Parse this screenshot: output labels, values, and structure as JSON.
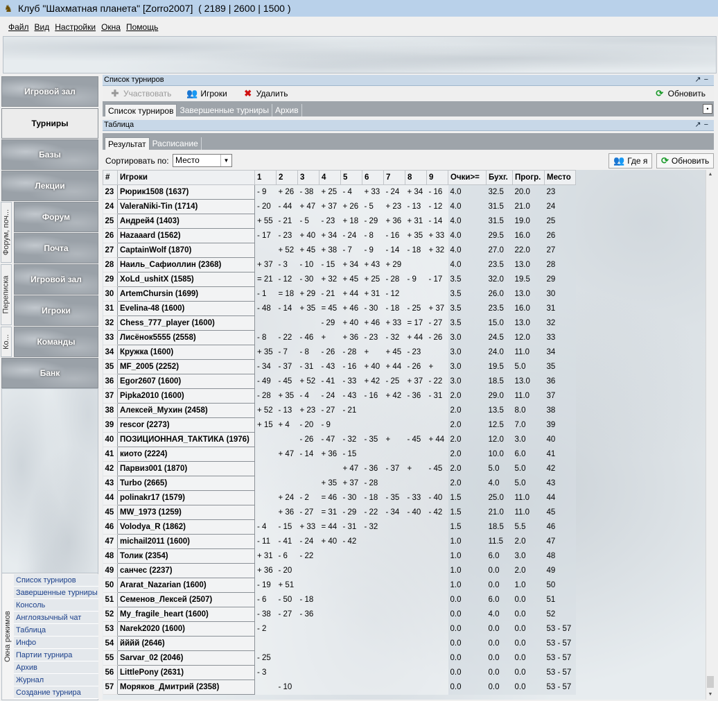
{
  "window": {
    "title": "Клуб \"Шахматная планета\" [Zorro2007]  ( 2189 | 2600 | 1500 )"
  },
  "menu": [
    "Файл",
    "Вид",
    "Настройки",
    "Окна",
    "Помощь"
  ],
  "sidebar": {
    "buttons": [
      "Игровой зал",
      "Турниры",
      "Базы",
      "Лекции",
      "Форум",
      "Почта",
      "Игровой зал",
      "Игроки",
      "Команды",
      "Банк"
    ],
    "groups": [
      "Форум, поч...",
      "Переписка",
      "Ко..."
    ],
    "modes_label": "Окна режимов",
    "modes": [
      "Список турниров",
      "Завершенные турниры",
      "Консоль",
      "Англоязычный чат",
      "Таблица",
      "Инфо",
      "Партии турнира",
      "Архив",
      "Журнал",
      "Создание турнира"
    ]
  },
  "tournament_list": {
    "header": "Список турниров",
    "toolbar": {
      "participate": "Участвовать",
      "players": "Игроки",
      "delete": "Удалить",
      "refresh": "Обновить"
    },
    "tabs": [
      "Список турниров",
      "Завершенные турниры",
      "Архив"
    ]
  },
  "table_panel": {
    "header": "Таблица",
    "tabs": [
      "Результат",
      "Расписание"
    ],
    "sort_label": "Сортировать по:",
    "sort_value": "Место",
    "where_button": "Где я",
    "refresh_button": "Обновить"
  },
  "grid": {
    "columns": [
      "#",
      "Игроки",
      "1",
      "2",
      "3",
      "4",
      "5",
      "6",
      "7",
      "8",
      "9",
      "Очки>=",
      "Бухг.",
      "Прогр.",
      "Место"
    ],
    "rows": [
      [
        "23",
        "Рюрик1508 (1637)",
        "- 9",
        "+ 26",
        "- 38",
        "+ 25",
        "- 4",
        "+ 33",
        "- 24",
        "+ 34",
        "- 16",
        "4.0",
        "32.5",
        "20.0",
        "23"
      ],
      [
        "24",
        "ValeraNiki-Tin (1714)",
        "- 20",
        "- 44",
        "+ 47",
        "+ 37",
        "+ 26",
        "- 5",
        "+ 23",
        "- 13",
        "- 12",
        "4.0",
        "31.5",
        "21.0",
        "24"
      ],
      [
        "25",
        "Андрей4 (1403)",
        "+ 55",
        "- 21",
        "- 5",
        "- 23",
        "+ 18",
        "- 29",
        "+ 36",
        "+ 31",
        "- 14",
        "4.0",
        "31.5",
        "19.0",
        "25"
      ],
      [
        "26",
        "Hazaaard (1562)",
        "- 17",
        "- 23",
        "+ 40",
        "+ 34",
        "- 24",
        "- 8",
        "- 16",
        "+ 35",
        "+ 33",
        "4.0",
        "29.5",
        "16.0",
        "26"
      ],
      [
        "27",
        "CaptainWolf (1870)",
        "",
        "+ 52",
        "+ 45",
        "+ 38",
        "- 7",
        "- 9",
        "- 14",
        "- 18",
        "+ 32",
        "4.0",
        "27.0",
        "22.0",
        "27"
      ],
      [
        "28",
        "Наиль_Сафиоллин (2368)",
        "+ 37",
        "- 3",
        "- 10",
        "- 15",
        "+ 34",
        "+ 43",
        "+ 29",
        "",
        "",
        "4.0",
        "23.5",
        "13.0",
        "28"
      ],
      [
        "29",
        "XoLd_ushitX (1585)",
        "= 21",
        "- 12",
        "- 30",
        "+ 32",
        "+ 45",
        "+ 25",
        "- 28",
        "- 9",
        "- 17",
        "3.5",
        "32.0",
        "19.5",
        "29"
      ],
      [
        "30",
        "ArtemChursin (1699)",
        "- 1",
        "= 18",
        "+ 29",
        "- 21",
        "+ 44",
        "+ 31",
        "- 12",
        "",
        "",
        "3.5",
        "26.0",
        "13.0",
        "30"
      ],
      [
        "31",
        "Evelina-48 (1600)",
        "- 48",
        "- 14",
        "+ 35",
        "= 45",
        "+ 46",
        "- 30",
        "- 18",
        "- 25",
        "+ 37",
        "3.5",
        "23.5",
        "16.0",
        "31"
      ],
      [
        "32",
        "Chess_777_player (1600)",
        "",
        "",
        "",
        "- 29",
        "+ 40",
        "+ 46",
        "+ 33",
        "= 17",
        "- 27",
        "3.5",
        "15.0",
        "13.0",
        "32"
      ],
      [
        "33",
        "Лисёнок5555 (2558)",
        "- 8",
        "- 22",
        "- 46",
        "+",
        "+ 36",
        "- 23",
        "- 32",
        "+ 44",
        "- 26",
        "3.0",
        "24.5",
        "12.0",
        "33"
      ],
      [
        "34",
        "Кружка (1600)",
        "+ 35",
        "- 7",
        "- 8",
        "- 26",
        "- 28",
        "+",
        "+ 45",
        "- 23",
        "",
        "3.0",
        "24.0",
        "11.0",
        "34"
      ],
      [
        "35",
        "MF_2005 (2252)",
        "- 34",
        "- 37",
        "- 31",
        "- 43",
        "- 16",
        "+ 40",
        "+ 44",
        "- 26",
        "+",
        "3.0",
        "19.5",
        "5.0",
        "35"
      ],
      [
        "36",
        "Egor2607 (1600)",
        "- 49",
        "- 45",
        "+ 52",
        "- 41",
        "- 33",
        "+ 42",
        "- 25",
        "+ 37",
        "- 22",
        "3.0",
        "18.5",
        "13.0",
        "36"
      ],
      [
        "37",
        "Pipka2010 (1600)",
        "- 28",
        "+ 35",
        "- 4",
        "- 24",
        "- 43",
        "- 16",
        "+ 42",
        "- 36",
        "- 31",
        "2.0",
        "29.0",
        "11.0",
        "37"
      ],
      [
        "38",
        "Алексей_Мухин (2458)",
        "+ 52",
        "- 13",
        "+ 23",
        "- 27",
        "- 21",
        "",
        "",
        "",
        "",
        "2.0",
        "13.5",
        "8.0",
        "38"
      ],
      [
        "39",
        "rescor (2273)",
        "+ 15",
        "+ 4",
        "- 20",
        "- 9",
        "",
        "",
        "",
        "",
        "",
        "2.0",
        "12.5",
        "7.0",
        "39"
      ],
      [
        "40",
        "ПОЗИЦИОННАЯ_ТАКТИКА (1976)",
        "",
        "",
        "- 26",
        "- 47",
        "- 32",
        "- 35",
        "+",
        "- 45",
        "+ 44",
        "2.0",
        "12.0",
        "3.0",
        "40"
      ],
      [
        "41",
        "киото (2224)",
        "",
        "+ 47",
        "- 14",
        "+ 36",
        "- 15",
        "",
        "",
        "",
        "",
        "2.0",
        "10.0",
        "6.0",
        "41"
      ],
      [
        "42",
        "Парвиз001 (1870)",
        "",
        "",
        "",
        "",
        "+ 47",
        "- 36",
        "- 37",
        "+",
        "- 45",
        "2.0",
        "5.0",
        "5.0",
        "42"
      ],
      [
        "43",
        "Turbo (2665)",
        "",
        "",
        "",
        "+ 35",
        "+ 37",
        "- 28",
        "",
        "",
        "",
        "2.0",
        "4.0",
        "5.0",
        "43"
      ],
      [
        "44",
        "polinakr17 (1579)",
        "",
        "+ 24",
        "- 2",
        "= 46",
        "- 30",
        "- 18",
        "- 35",
        "- 33",
        "- 40",
        "1.5",
        "25.0",
        "11.0",
        "44"
      ],
      [
        "45",
        "MW_1973 (1259)",
        "",
        "+ 36",
        "- 27",
        "= 31",
        "- 29",
        "- 22",
        "- 34",
        "- 40",
        "- 42",
        "1.5",
        "21.0",
        "11.0",
        "45"
      ],
      [
        "46",
        "Volodya_R (1862)",
        "- 4",
        "- 15",
        "+ 33",
        "= 44",
        "- 31",
        "- 32",
        "",
        "",
        "",
        "1.5",
        "18.5",
        "5.5",
        "46"
      ],
      [
        "47",
        "michail2011 (1600)",
        "- 11",
        "- 41",
        "- 24",
        "+ 40",
        "- 42",
        "",
        "",
        "",
        "",
        "1.0",
        "11.5",
        "2.0",
        "47"
      ],
      [
        "48",
        "Толик (2354)",
        "+ 31",
        "- 6",
        "- 22",
        "",
        "",
        "",
        "",
        "",
        "",
        "1.0",
        "6.0",
        "3.0",
        "48"
      ],
      [
        "49",
        "санчес (2237)",
        "+ 36",
        "- 20",
        "",
        "",
        "",
        "",
        "",
        "",
        "",
        "1.0",
        "0.0",
        "2.0",
        "49"
      ],
      [
        "50",
        "Ararat_Nazarian (1600)",
        "- 19",
        "+ 51",
        "",
        "",
        "",
        "",
        "",
        "",
        "",
        "1.0",
        "0.0",
        "1.0",
        "50"
      ],
      [
        "51",
        "Семенов_Лексей (2507)",
        "- 6",
        "- 50",
        "- 18",
        "",
        "",
        "",
        "",
        "",
        "",
        "0.0",
        "6.0",
        "0.0",
        "51"
      ],
      [
        "52",
        "My_fragile_heart (1600)",
        "- 38",
        "- 27",
        "- 36",
        "",
        "",
        "",
        "",
        "",
        "",
        "0.0",
        "4.0",
        "0.0",
        "52"
      ],
      [
        "53",
        "Narek2020 (1600)",
        "- 2",
        "",
        "",
        "",
        "",
        "",
        "",
        "",
        "",
        "0.0",
        "0.0",
        "0.0",
        "53 - 57"
      ],
      [
        "54",
        "йййй (2646)",
        "",
        "",
        "",
        "",
        "",
        "",
        "",
        "",
        "",
        "0.0",
        "0.0",
        "0.0",
        "53 - 57"
      ],
      [
        "55",
        "Sarvar_02 (2046)",
        "- 25",
        "",
        "",
        "",
        "",
        "",
        "",
        "",
        "",
        "0.0",
        "0.0",
        "0.0",
        "53 - 57"
      ],
      [
        "56",
        "LittlePony (2631)",
        "- 3",
        "",
        "",
        "",
        "",
        "",
        "",
        "",
        "",
        "0.0",
        "0.0",
        "0.0",
        "53 - 57"
      ],
      [
        "57",
        "Моряков_Дмитрий (2358)",
        "",
        "- 10",
        "",
        "",
        "",
        "",
        "",
        "",
        "",
        "0.0",
        "0.0",
        "0.0",
        "53 - 57"
      ]
    ]
  }
}
